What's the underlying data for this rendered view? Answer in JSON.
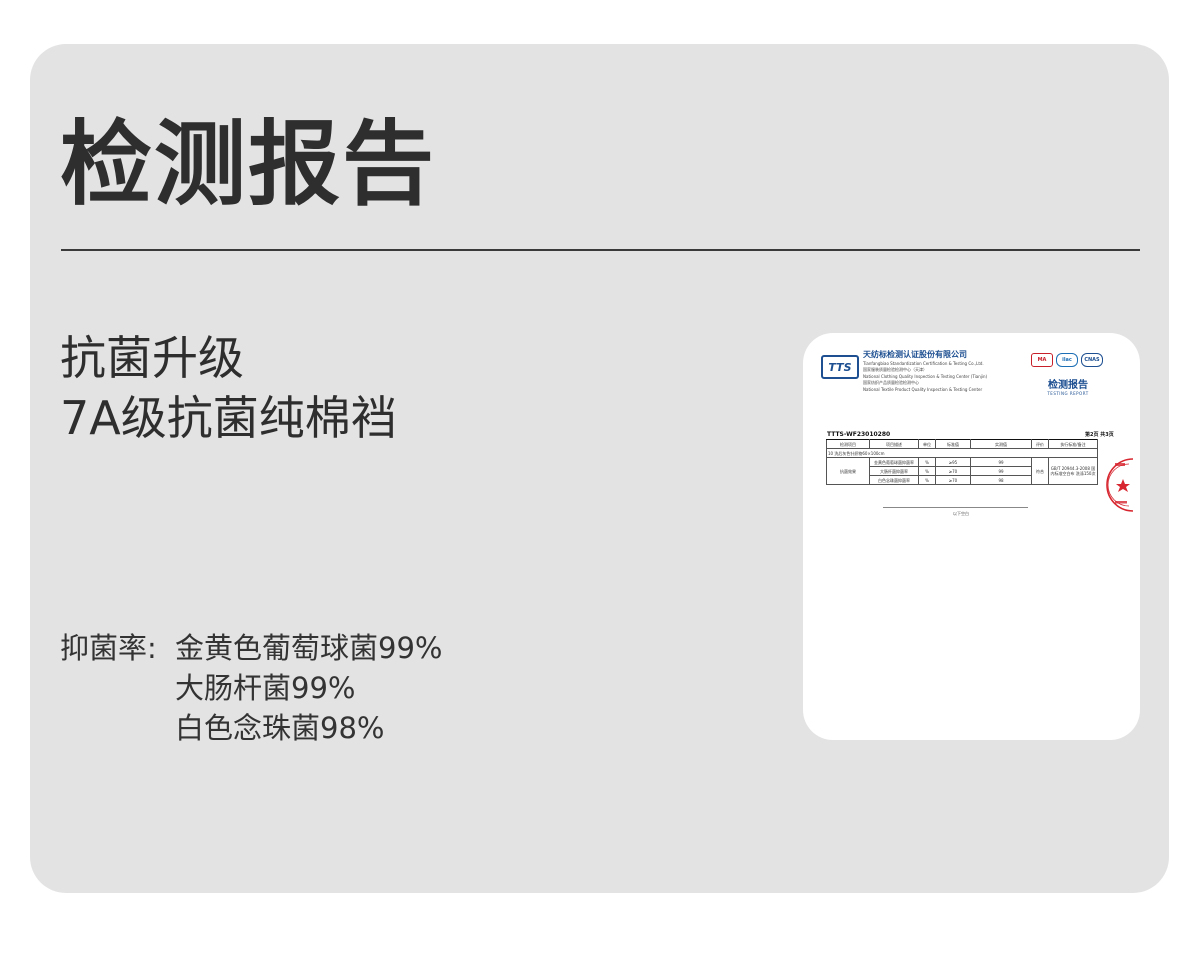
{
  "header": {
    "title": "检测报告"
  },
  "subtitle": {
    "line1": "抗菌升级",
    "line2": "7A级抗菌纯棉裆"
  },
  "rates": {
    "label": "抑菌率:",
    "items": [
      "金黄色葡萄球菌99%",
      "大肠杆菌99%",
      "白色念珠菌98%"
    ]
  },
  "report": {
    "logo": "TTS",
    "org_name": "天纺标检测认证股份有限公司",
    "org_lines": [
      "Tianfangbiao Standardization Certification & Testing Co.,Ltd.",
      "国家服装质量检验检测中心（天津）",
      "National Clothing Quality Inspection & Testing Center (Tianjin)",
      "国家纺织产品质量检验检测中心",
      "National Textile Product Quality Inspection & Testing Center"
    ],
    "certs": [
      "MA",
      "ilac",
      "CNAS"
    ],
    "title_zh": "检测报告",
    "title_en": "TESTING REPORT",
    "report_no": "TTTS-WF23010280",
    "page": "第2页  共3页",
    "table": {
      "headers": [
        "检测项目",
        "项目描述",
        "单位",
        "标准值",
        "实测值",
        "评价",
        "执行标准/备注"
      ],
      "section": "10    洗后灰色针织物60×100cm",
      "item": "抗菌效果",
      "rows": [
        {
          "desc": "金黄色葡萄球菌抑菌率",
          "unit": "%",
          "std": "≥95",
          "val": "99"
        },
        {
          "desc": "大肠杆菌抑菌率",
          "unit": "%",
          "std": "≥70",
          "val": "99"
        },
        {
          "desc": "白色念珠菌抑菌率",
          "unit": "%",
          "std": "≥70",
          "val": "98"
        }
      ],
      "evaluation": "符合",
      "standard_note": "GB/T 20944.3-2008 国内标准空白布 洗涤150次"
    },
    "end_note": "以下空白"
  },
  "colors": {
    "panel_bg": "#e3e3e3",
    "title_text": "#2e2e2e",
    "brand_blue": "#1d4f91",
    "stamp_red": "#d7262f"
  }
}
